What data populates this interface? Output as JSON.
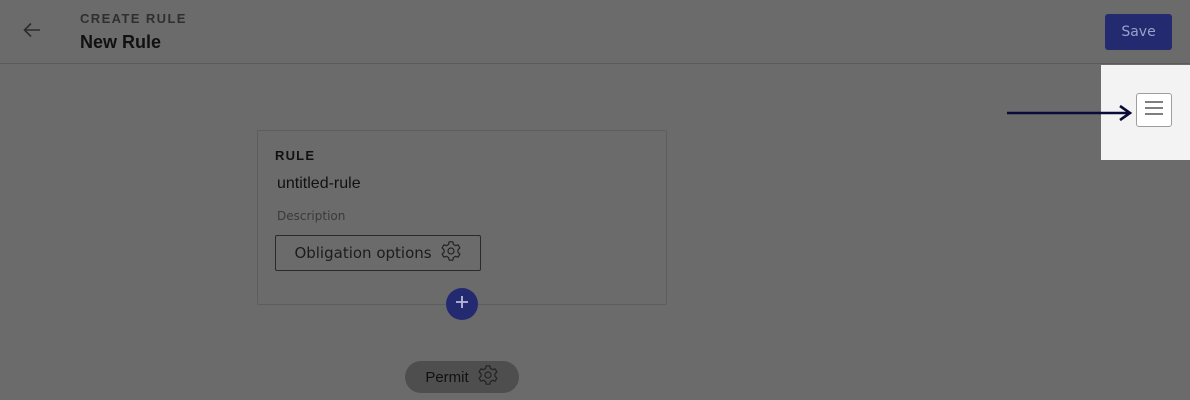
{
  "header": {
    "eyebrow": "CREATE RULE",
    "title": "New Rule",
    "save_label": "Save",
    "back_icon": "arrow-left-icon"
  },
  "menu": {
    "icon": "hamburger-menu-icon"
  },
  "rule_card": {
    "heading": "RULE",
    "name": "untitled-rule",
    "description_placeholder": "Description",
    "obligation_label": "Obligation options",
    "obligation_icon": "gear-icon"
  },
  "add_button": {
    "icon": "plus-icon"
  },
  "permit_chip": {
    "label": "Permit",
    "icon": "gear-icon"
  },
  "colors": {
    "overlay_background": "#6b6b6b",
    "accent": "#232a70",
    "menu_panel": "#f3f3f3",
    "pointer_arrow": "#0b0b3a"
  }
}
